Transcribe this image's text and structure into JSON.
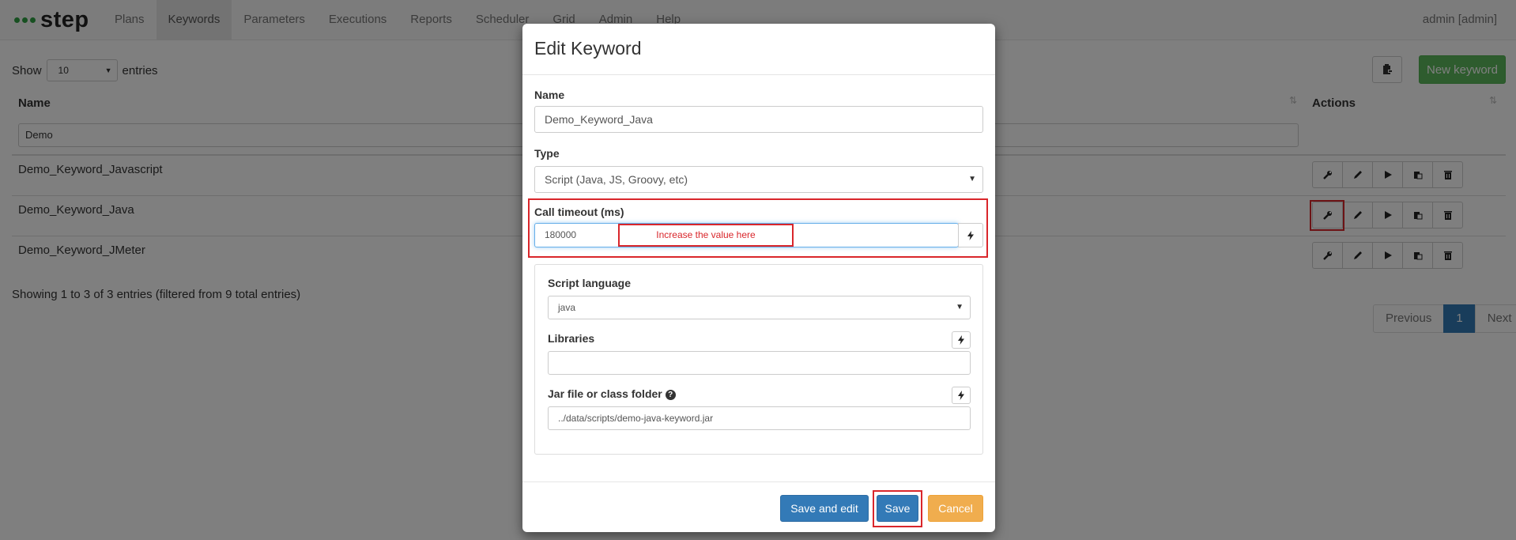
{
  "brand": {
    "name": "step"
  },
  "nav": {
    "items": [
      "Plans",
      "Keywords",
      "Parameters",
      "Executions",
      "Reports",
      "Scheduler",
      "Grid",
      "Admin",
      "Help"
    ],
    "active": "Keywords",
    "user": "admin [admin]"
  },
  "list": {
    "show_label": "Show",
    "page_size": "10",
    "entries_label": "entries",
    "new_keyword_label": "New keyword",
    "columns": {
      "name": "Name",
      "actions": "Actions"
    },
    "filter_value": "Demo",
    "rows": [
      "Demo_Keyword_Javascript",
      "Demo_Keyword_Java",
      "Demo_Keyword_JMeter"
    ],
    "showing_text": "Showing 1 to 3 of 3 entries (filtered from 9 total entries)",
    "pagination": {
      "previous": "Previous",
      "current": "1",
      "next": "Next"
    },
    "action_icons": [
      "wrench-icon",
      "pencil-icon",
      "play-icon",
      "copy-icon",
      "trash-icon"
    ]
  },
  "modal": {
    "title": "Edit Keyword",
    "name_label": "Name",
    "name_value": "Demo_Keyword_Java",
    "type_label": "Type",
    "type_value": "Script (Java, JS, Groovy, etc)",
    "timeout_label": "Call timeout (ms)",
    "timeout_value": "180000",
    "timeout_note": "Increase the value here",
    "script_language_label": "Script language",
    "script_language_value": "java",
    "libraries_label": "Libraries",
    "libraries_value": "",
    "jar_label": "Jar file or class folder",
    "jar_value": "../data/scripts/demo-java-keyword.jar",
    "buttons": {
      "save_and_edit": "Save and edit",
      "save": "Save",
      "cancel": "Cancel"
    }
  },
  "colors": {
    "primary": "#337ab7",
    "success": "#5cb85c",
    "warning": "#f0ad4e",
    "highlight": "#d9262b",
    "brand_dots": "#2ea043"
  }
}
